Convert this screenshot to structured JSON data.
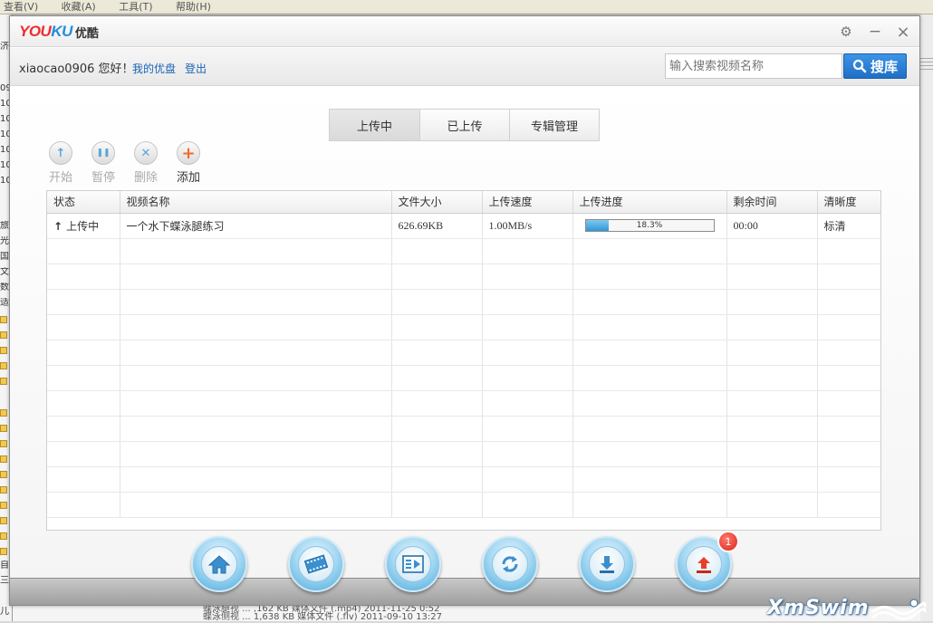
{
  "background": {
    "menu": [
      "查看(V)",
      "收藏(A)",
      "工具(T)",
      "帮助(H)"
    ],
    "left_fragments": [
      "济",
      "09",
      "10",
      "10",
      "10",
      "10",
      "10",
      "10",
      "旅",
      "光",
      "国",
      "文",
      "数",
      "适",
      "自",
      "三",
      "儿"
    ],
    "bottom_rows": [
      "蝶泳腿视  ...  ,162 KB  媒体文件 (.mp4)  2011-11-25 0:52",
      "蝶泳侧视  ...  1,638 KB  媒体文件 (.flv)  2011-09-10 13:27"
    ]
  },
  "titlebar": {
    "logo_you": "YOU",
    "logo_ku": "KU",
    "logo_cn": "优酷",
    "settings_icon": "⚙",
    "minimize_icon": "−",
    "close_icon": "×"
  },
  "header": {
    "greeting": "xiaocao0906 您好！",
    "my_disk": "我的优盘",
    "logout": "登出",
    "search_placeholder": "输入搜索视频名称",
    "search_button": "搜库"
  },
  "tabs": [
    {
      "label": "上传中",
      "active": true
    },
    {
      "label": "已上传",
      "active": false
    },
    {
      "label": "专辑管理",
      "active": false
    }
  ],
  "toolbar": [
    {
      "label": "开始",
      "icon": "up-arrow-icon",
      "glyph": "↑",
      "color": "#5aa7d8",
      "enabled": false
    },
    {
      "label": "暂停",
      "icon": "pause-icon",
      "glyph": "❚❚",
      "color": "#5aa7d8",
      "enabled": false
    },
    {
      "label": "删除",
      "icon": "delete-icon",
      "glyph": "✕",
      "color": "#5aa7d8",
      "enabled": false
    },
    {
      "label": "添加",
      "icon": "add-icon",
      "glyph": "+",
      "color": "#f06a2a",
      "enabled": true
    }
  ],
  "table": {
    "columns": [
      "状态",
      "视频名称",
      "文件大小",
      "上传速度",
      "上传进度",
      "剩余时间",
      "清晰度"
    ],
    "rows": [
      {
        "status": "上传中",
        "name": "一个水下蝶泳腿练习",
        "size": "626.69KB",
        "speed": "1.00MB/s",
        "progress": 18.3,
        "progress_text": "18.3%",
        "remaining": "00:00",
        "quality": "标清"
      }
    ]
  },
  "dock": [
    {
      "name": "home"
    },
    {
      "name": "video"
    },
    {
      "name": "playlist"
    },
    {
      "name": "refresh"
    },
    {
      "name": "download"
    },
    {
      "name": "upload"
    }
  ],
  "upload_badge": "1",
  "watermark": "XmSwim"
}
